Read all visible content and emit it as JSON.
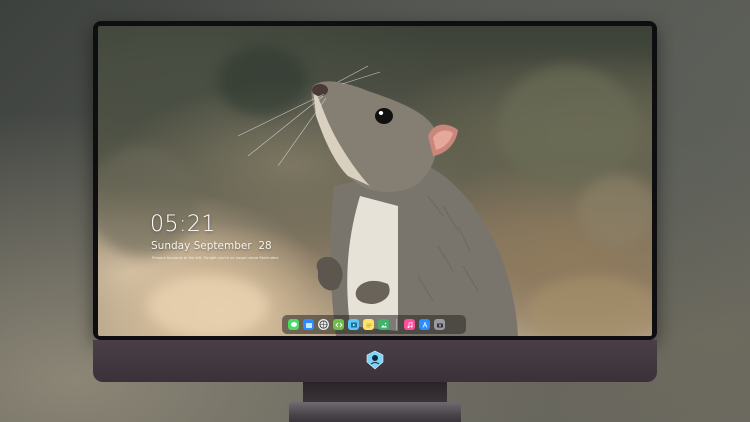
{
  "lock_screen": {
    "time": "05:21",
    "date": "Sunday September  28",
    "hint": "Prepare forwards to the left, Tonight you're no longer alone    Reminders"
  },
  "dock": {
    "icons": [
      {
        "name": "messages-icon",
        "color": "#4cd964"
      },
      {
        "name": "files-icon",
        "color": "#2f8cff"
      },
      {
        "name": "browser-icon",
        "color": "#e8e8e8"
      },
      {
        "name": "code-icon",
        "color": "#6fbf4a"
      },
      {
        "name": "media-icon",
        "color": "#5ac8fa"
      },
      {
        "name": "notes-icon",
        "color": "#ffd43b"
      },
      {
        "name": "images-icon",
        "color": "#3fb36b"
      },
      {
        "name": "music-icon",
        "color": "#ff4f9a"
      },
      {
        "name": "app-store-icon",
        "color": "#2d8cff"
      },
      {
        "name": "camera-icon",
        "color": "#9a9aa0"
      }
    ]
  },
  "colors": {
    "bezel": "#0e0d10",
    "chin": "#4a3f47"
  }
}
